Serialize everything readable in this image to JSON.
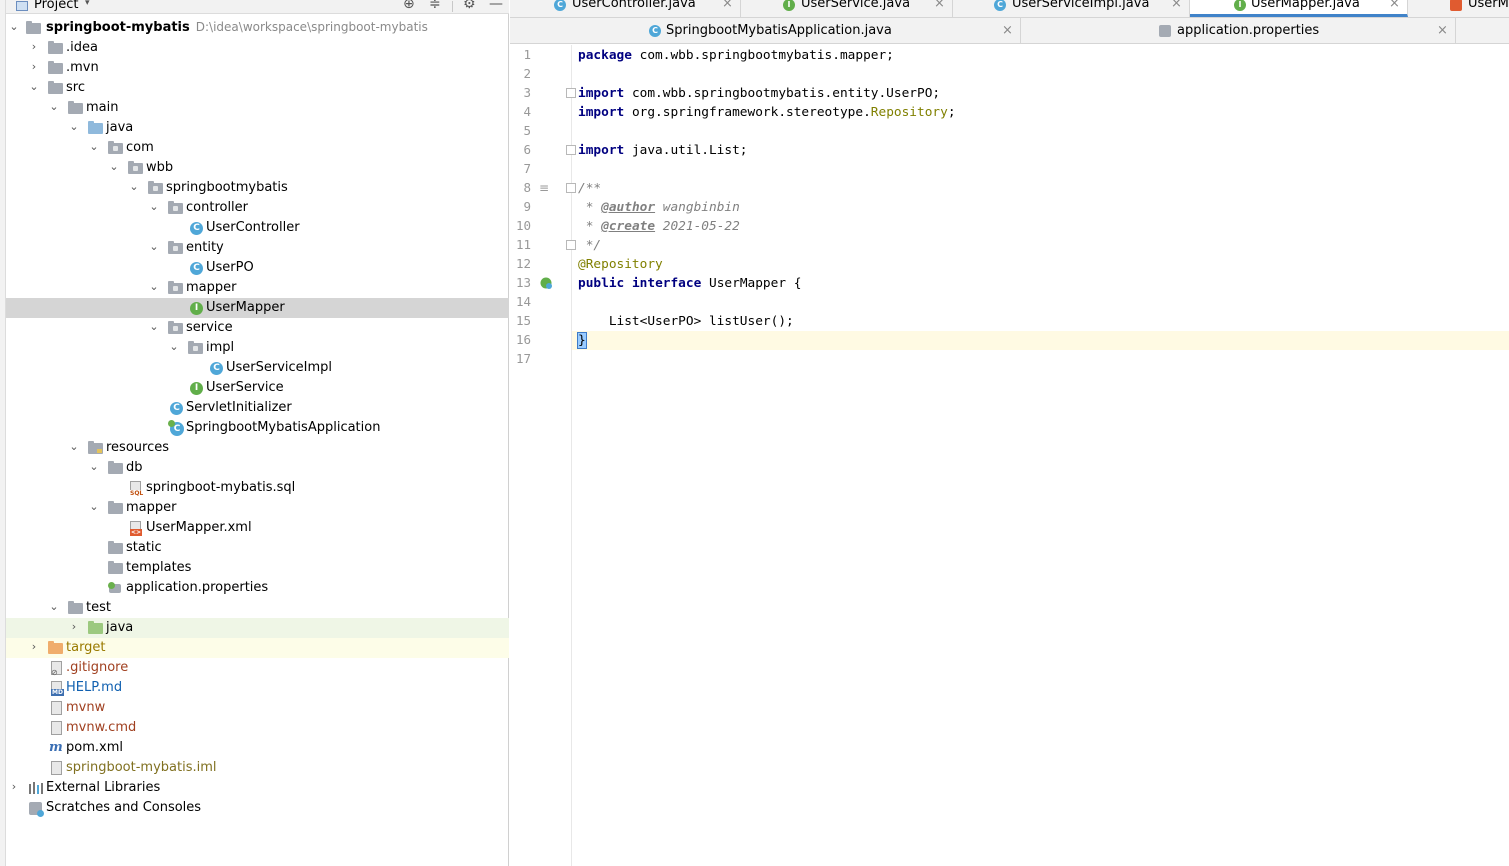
{
  "project_panel": {
    "title": "Project",
    "root_name": "springboot-mybatis",
    "root_path": "D:\\idea\\workspace\\springboot-mybatis",
    "tree": [
      {
        "label": "springboot-mybatis",
        "icon": "module-folder-icon",
        "expanded": true
      },
      {
        "label": ".idea",
        "icon": "folder-icon",
        "expanded": false
      },
      {
        "label": ".mvn",
        "icon": "folder-icon",
        "expanded": false
      },
      {
        "label": "src",
        "icon": "folder-icon",
        "expanded": true
      },
      {
        "label": "main",
        "icon": "folder-icon",
        "expanded": true
      },
      {
        "label": "java",
        "icon": "source-folder-icon",
        "expanded": true
      },
      {
        "label": "com",
        "icon": "package-icon",
        "expanded": true
      },
      {
        "label": "wbb",
        "icon": "package-icon",
        "expanded": true
      },
      {
        "label": "springbootmybatis",
        "icon": "package-icon",
        "expanded": true
      },
      {
        "label": "controller",
        "icon": "package-icon",
        "expanded": true
      },
      {
        "label": "UserController",
        "icon": "class-icon"
      },
      {
        "label": "entity",
        "icon": "package-icon",
        "expanded": true
      },
      {
        "label": "UserPO",
        "icon": "class-icon"
      },
      {
        "label": "mapper",
        "icon": "package-icon",
        "expanded": true
      },
      {
        "label": "UserMapper",
        "icon": "interface-icon",
        "selected": true
      },
      {
        "label": "service",
        "icon": "package-icon",
        "expanded": true
      },
      {
        "label": "impl",
        "icon": "package-icon",
        "expanded": true
      },
      {
        "label": "UserServiceImpl",
        "icon": "class-icon"
      },
      {
        "label": "UserService",
        "icon": "interface-icon"
      },
      {
        "label": "ServletInitializer",
        "icon": "class-icon"
      },
      {
        "label": "SpringbootMybatisApplication",
        "icon": "spring-boot-class-icon"
      },
      {
        "label": "resources",
        "icon": "resources-folder-icon",
        "expanded": true
      },
      {
        "label": "db",
        "icon": "folder-icon",
        "expanded": true
      },
      {
        "label": "springboot-mybatis.sql",
        "icon": "sql-file-icon"
      },
      {
        "label": "mapper",
        "icon": "folder-icon",
        "expanded": true
      },
      {
        "label": "UserMapper.xml",
        "icon": "xml-file-icon"
      },
      {
        "label": "static",
        "icon": "folder-icon"
      },
      {
        "label": "templates",
        "icon": "folder-icon"
      },
      {
        "label": "application.properties",
        "icon": "properties-file-icon"
      },
      {
        "label": "test",
        "icon": "folder-icon",
        "expanded": true
      },
      {
        "label": "java",
        "icon": "test-source-folder-icon",
        "expanded": false
      },
      {
        "label": "target",
        "icon": "excluded-folder-icon",
        "expanded": false
      },
      {
        "label": ".gitignore",
        "icon": "gitignore-file-icon"
      },
      {
        "label": "HELP.md",
        "icon": "markdown-file-icon"
      },
      {
        "label": "mvnw",
        "icon": "text-file-icon"
      },
      {
        "label": "mvnw.cmd",
        "icon": "text-file-icon"
      },
      {
        "label": "pom.xml",
        "icon": "maven-icon"
      },
      {
        "label": "springboot-mybatis.iml",
        "icon": "iml-file-icon"
      },
      {
        "label": "External Libraries",
        "icon": "libraries-icon",
        "expanded": false
      },
      {
        "label": "Scratches and Consoles",
        "icon": "scratches-icon"
      }
    ]
  },
  "editor": {
    "tabs_row1": [
      {
        "label": "UserController.java",
        "icon": "class-icon"
      },
      {
        "label": "UserService.java",
        "icon": "interface-icon"
      },
      {
        "label": "UserServiceImpl.java",
        "icon": "class-icon"
      },
      {
        "label": "UserMapper.java",
        "icon": "interface-icon",
        "active": true
      },
      {
        "label": "UserM",
        "icon": "xml-file-icon"
      }
    ],
    "tabs_row2": [
      {
        "label": "SpringbootMybatisApplication.java",
        "icon": "spring-boot-class-icon"
      },
      {
        "label": "application.properties",
        "icon": "properties-file-icon"
      }
    ],
    "close_glyph": "×",
    "line_numbers": [
      "1",
      "2",
      "3",
      "4",
      "5",
      "6",
      "7",
      "8",
      "9",
      "10",
      "11",
      "12",
      "13",
      "14",
      "15",
      "16",
      "17"
    ],
    "code": {
      "l1_kw": "package",
      "l1_rest": " com.wbb.springbootmybatis.mapper;",
      "l3_kw": "import",
      "l3_rest": " com.wbb.springbootmybatis.entity.UserPO;",
      "l4_kw": "import",
      "l4_pre": " org.springframework.stereotype.",
      "l4_ann": "Repository",
      "l4_post": ";",
      "l6_kw": "import",
      "l6_rest": " java.util.List;",
      "l8": "/**",
      "l9_pre": " * ",
      "l9_tag": "@author",
      "l9_val": " wangbinbin",
      "l10_pre": " * ",
      "l10_tag": "@create",
      "l10_val": " 2021-05-22",
      "l11": " */",
      "l12": "@Repository",
      "l13_kw1": "public",
      "l13_kw2": "interface",
      "l13_name": " UserMapper ",
      "l13_brace": "{",
      "l15": "    List<UserPO> listUser();",
      "l16": "}"
    }
  },
  "colors": {
    "keyword": "#000080",
    "annotation": "#808000",
    "comment": "#808080",
    "selection": "#d5d5d5",
    "current_line": "#fffae3",
    "active_tab_underline": "#4083c9"
  }
}
